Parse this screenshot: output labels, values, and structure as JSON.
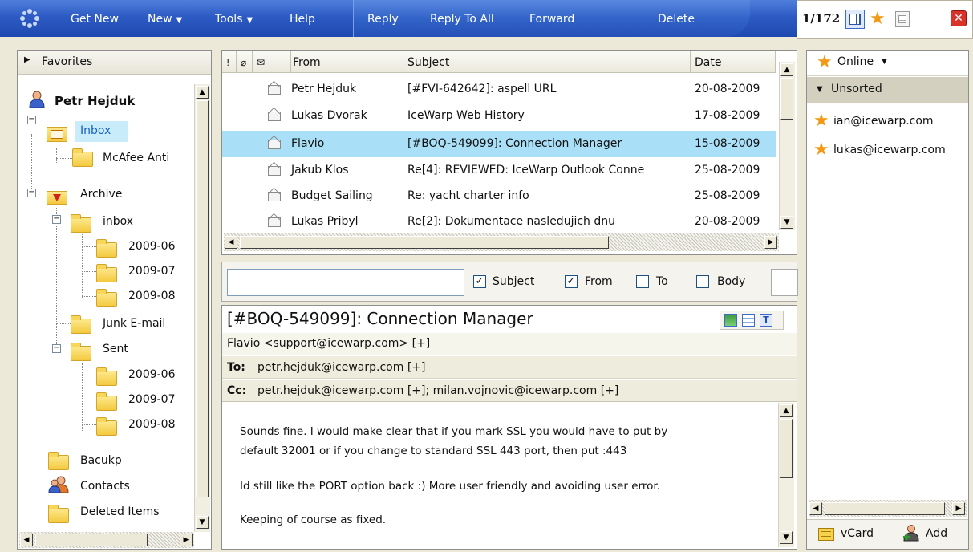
{
  "toolbar": {
    "get_new": "Get New",
    "new": "New",
    "tools": "Tools",
    "help": "Help",
    "reply": "Reply",
    "reply_all": "Reply To All",
    "forward": "Forward",
    "delete": "Delete",
    "counter": "1/172"
  },
  "left": {
    "favorites": "Favorites",
    "user": "Petr Hejduk",
    "folders": {
      "inbox": "Inbox",
      "mcafee": "McAfee Anti",
      "archive": "Archive",
      "archive_inbox": "inbox",
      "a_2009_06": "2009-06",
      "a_2009_07": "2009-07",
      "a_2009_08": "2009-08",
      "junk": "Junk E-mail",
      "sent": "Sent",
      "s_2009_06": "2009-06",
      "s_2009_07": "2009-07",
      "s_2009_08": "2009-08",
      "backup": "Bacukp",
      "contacts": "Contacts",
      "deleted": "Deleted Items"
    }
  },
  "list": {
    "columns": {
      "from": "From",
      "subject": "Subject",
      "date": "Date"
    },
    "rows": [
      {
        "from": "Petr Hejduk",
        "subject": "[#FVI-642642]: aspell URL",
        "date": "20-08-2009"
      },
      {
        "from": "Lukas Dvorak",
        "subject": "IceWarp Web History",
        "date": "17-08-2009"
      },
      {
        "from": "Flavio",
        "subject": "[#BOQ-549099]: Connection Manager",
        "date": "15-08-2009"
      },
      {
        "from": "Jakub Klos",
        "subject": "Re[4]: REVIEWED: IceWarp Outlook Conne",
        "date": "25-08-2009"
      },
      {
        "from": "Budget Sailing",
        "subject": "Re: yacht charter info",
        "date": "25-08-2009"
      },
      {
        "from": "Lukas Pribyl",
        "subject": "Re[2]: Dokumentace nasledujich dnu",
        "date": "20-08-2009"
      }
    ]
  },
  "search": {
    "subject": "Subject",
    "from": "From",
    "to": "To",
    "body": "Body"
  },
  "preview": {
    "title": "[#BOQ-549099]: Connection Manager",
    "from": "Flavio <support@icewarp.com> [+]",
    "to_label": "To:",
    "to": "petr.hejduk@icewarp.com [+]",
    "cc_label": "Cc:",
    "cc": "petr.hejduk@icewarp.com [+]; milan.vojnovic@icewarp.com [+]",
    "body1": "Sounds fine. I would make clear that if you mark SSL you would have to put by",
    "body2": "default 32001 or if you change to standard SSL 443 port, then put :443",
    "body3": "Id still like the PORT option back :) More user friendly and avoiding user error.",
    "body4": "Keeping of course as fixed."
  },
  "right": {
    "status": "Online",
    "group": "Unsorted",
    "contacts": [
      "ian@icewarp.com",
      "lukas@icewarp.com"
    ],
    "vcard": "vCard",
    "add": "Add"
  }
}
